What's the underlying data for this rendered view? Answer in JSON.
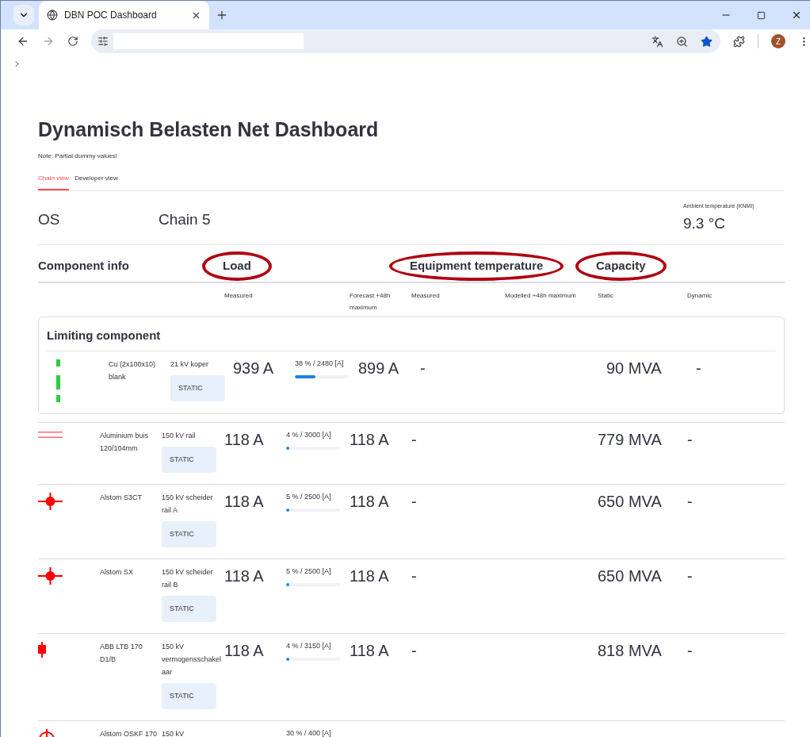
{
  "browser": {
    "tab_title": "DBN POC Dashboard",
    "profile_initial": "Z"
  },
  "title": "Dynamisch Belasten Net Dashboard",
  "note": "Note: Partial dummy values!",
  "tabs": [
    {
      "label": "Chain view",
      "selected": true
    },
    {
      "label": "Developer view",
      "selected": false
    }
  ],
  "station": "OS",
  "chain": "Chain 5",
  "ambient": {
    "label": "Ambient temperature (KNMI)",
    "value": "9.3 °C"
  },
  "section_headers": [
    {
      "label": "Component info",
      "highlighted": false
    },
    {
      "label": "Load",
      "highlighted": true
    },
    {
      "label": "Equipment temperature",
      "highlighted": true
    },
    {
      "label": "Capacity",
      "highlighted": true
    }
  ],
  "sub_headers": {
    "load_measured": "Measured",
    "load_forecast": "Forecast +48h maximum",
    "temp_measured": "Measured",
    "temp_modelled": "Modelled +48h maximum",
    "cap_static": "Static",
    "cap_dynamic": "Dynamic"
  },
  "limiting_component": {
    "title": "Limiting component",
    "row": {
      "kind": "busbar",
      "name": "Cu (2x100x10) blank",
      "voltage": "21 kV koper",
      "badge": "STATIC",
      "measured": "939 A",
      "usage": "38 % / 2480 [A]",
      "level": 0.38,
      "forecast": "899 A",
      "temp_measured": "-",
      "static": "90 MVA",
      "dynamic": "-"
    }
  },
  "rows": [
    {
      "kind": "rail",
      "name": "Aluminium buis 120/104mm",
      "voltage": "150 kV rail",
      "badge": "STATIC",
      "measured": "118 A",
      "usage": "4 % / 3000 [A]",
      "level": 0.04,
      "forecast": "118 A",
      "temp_measured": "-",
      "static": "779 MVA",
      "dynamic": "-"
    },
    {
      "kind": "disconnector",
      "name": "Alstom S3CT",
      "voltage": "150 kV scheider rail A",
      "badge": "STATIC",
      "measured": "118 A",
      "usage": "5 % / 2500 [A]",
      "level": 0.05,
      "forecast": "118 A",
      "temp_measured": "-",
      "static": "650 MVA",
      "dynamic": "-"
    },
    {
      "kind": "disconnector",
      "name": "Alstom SX",
      "voltage": "150 kV scheider rail B",
      "badge": "STATIC",
      "measured": "118 A",
      "usage": "5 % / 2500 [A]",
      "level": 0.05,
      "forecast": "118 A",
      "temp_measured": "-",
      "static": "650 MVA",
      "dynamic": "-"
    },
    {
      "kind": "breaker",
      "name": "ABB LTB 170 D1/B",
      "voltage": "150 kV vermogensschakelaar",
      "badge": "STATIC",
      "measured": "118 A",
      "usage": "4 % / 3150 [A]",
      "level": 0.04,
      "forecast": "118 A",
      "temp_measured": "-",
      "static": "818 MVA",
      "dynamic": "-"
    },
    {
      "kind": "transformer",
      "name": "Alstom OSKF 170",
      "voltage": "150 kV",
      "usage": "30 % / 400 [A]"
    }
  ]
}
